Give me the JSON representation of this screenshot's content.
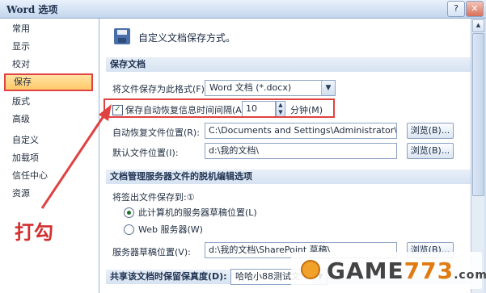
{
  "window": {
    "title": "Word 选项",
    "help_btn": "?",
    "close_btn": "✕"
  },
  "sidebar": {
    "items": [
      {
        "label": "常用"
      },
      {
        "label": "显示"
      },
      {
        "label": "校对"
      },
      {
        "label": "保存"
      },
      {
        "label": "版式"
      },
      {
        "label": "高级"
      },
      {
        "label": "自定义"
      },
      {
        "label": "加载项"
      },
      {
        "label": "信任中心"
      },
      {
        "label": "资源"
      }
    ],
    "selected_index": 3
  },
  "header": {
    "text": "自定义文档保存方式。"
  },
  "save_section": {
    "title": "保存文档",
    "format_label": "将文件保存为此格式(F):",
    "format_value": "Word 文档 (*.docx)",
    "autorecover_label": "保存自动恢复信息时间间隔(A)",
    "autorecover_checked": true,
    "autorecover_value": "10",
    "minutes_label": "分钟(M)",
    "autorecover_path_label": "自动恢复文件位置(R):",
    "autorecover_path": "C:\\Documents and Settings\\Administrator\\Appli",
    "browse_label": "浏览(B)...",
    "default_path_label": "默认文件位置(I):",
    "default_path": "d:\\我的文档\\"
  },
  "server_section": {
    "title": "文档管理服务器文件的脱机编辑选项",
    "checkout_label": "将签出文件保存到:①",
    "radio_server": "此计算机的服务器草稿位置(L)",
    "radio_web": "Web 服务器(W)",
    "drafts_label": "服务器草稿位置(V):",
    "drafts_path": "d:\\我的文档\\SharePoint 草稿\\"
  },
  "fidelity_section": {
    "title": "共享该文档时保留保真度(D):",
    "doc_value": "哈哈小88测试文"
  },
  "annotation": {
    "text": "打勾"
  },
  "watermark": {
    "text_a": "GAME",
    "text_b": "773",
    "text_c": ".com"
  },
  "colors": {
    "highlight": "#e04141",
    "selected_bg": "#ffc96a",
    "section_bg": "#dbe6f3"
  }
}
